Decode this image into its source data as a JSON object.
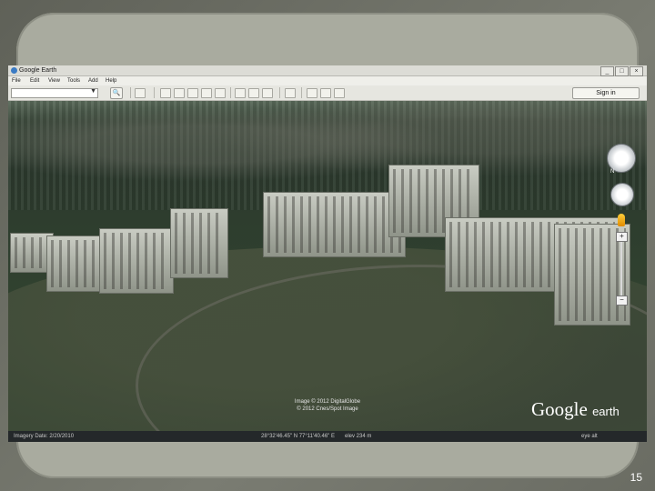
{
  "slide": {
    "number": "15"
  },
  "window": {
    "title": "Google Earth",
    "controls": {
      "minimize": "_",
      "maximize": "□",
      "close": "×"
    }
  },
  "menu": {
    "items": [
      "File",
      "Edit",
      "View",
      "Tools",
      "Add",
      "Help"
    ]
  },
  "toolbar": {
    "search_value": "",
    "dropdown": "▼",
    "go_label": "🔍",
    "signin_label": "Sign in"
  },
  "view": {
    "imagery_credit_line1": "Image © 2012 DigitalGlobe",
    "imagery_credit_line2": "© 2012 Cnes/Spot Image",
    "logo_text": "Google",
    "logo_suffix": "earth",
    "north_label": "N"
  },
  "zoom": {
    "plus": "+",
    "minus": "−"
  },
  "status": {
    "imagery_date": "Imagery Date: 2/20/2010",
    "coordinates": "28°32'46.45\" N  77°11'40.46\" E",
    "elevation": "elev 234 m",
    "eye_alt": "eye alt"
  }
}
